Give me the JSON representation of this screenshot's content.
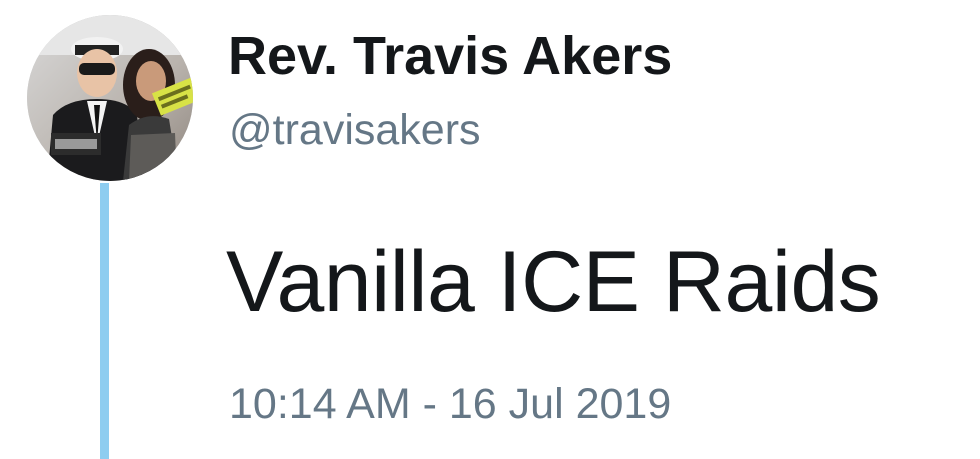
{
  "tweet": {
    "display_name": "Rev. Travis Akers",
    "handle": "@travisakers",
    "text": "Vanilla ICE Raids",
    "timestamp": "10:14 AM - 16 Jul 2019"
  },
  "colors": {
    "thread_line": "#8ecdf0",
    "text_primary": "#14171a",
    "text_secondary": "#657786"
  }
}
